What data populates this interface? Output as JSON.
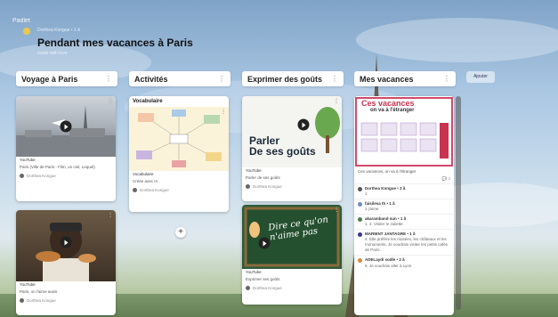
{
  "app": {
    "brand": "Padlet"
  },
  "board": {
    "author": "Dorthea Kongue • 1 ã",
    "title": "Pendant mes vacances à Paris",
    "subtitle": "made with love"
  },
  "add_section_label": "Ajouter",
  "columns": [
    {
      "title": "Voyage à Paris",
      "cards": [
        {
          "type": "video",
          "source": "YouTube",
          "caption": "Paris (Ville de Paris - Film, un ciel, Lequel)",
          "user": "Dorthea Kongue"
        },
        {
          "type": "video",
          "source": "YouTube",
          "caption": "Paris, on l'aime aussi",
          "user": "Dorthea Kongue"
        }
      ]
    },
    {
      "title": "Activités",
      "cards": [
        {
          "type": "image",
          "heading": "Vocabulaire",
          "label": "Vocabulaire",
          "caption": "Créée avec IA",
          "user": "Dorthea Kongue"
        }
      ]
    },
    {
      "title": "Exprimer des goûts",
      "cards": [
        {
          "type": "video",
          "source": "YouTube",
          "overlay_line1": "Parler",
          "overlay_line2": "De ses goûts",
          "caption": "Parler de ses goûts",
          "user": "Dorthea Kongue"
        },
        {
          "type": "video",
          "source": "YouTube",
          "overlay_line1": "Dire ce qu'on",
          "overlay_line2": "n'aime pas",
          "caption": "Exprimer ses goûts",
          "user": "Dorthea Kongue"
        }
      ]
    },
    {
      "title": "Mes vacances",
      "cards": [
        {
          "type": "image",
          "overlay_line1": "Ces vacances",
          "overlay_line2": "on va à l'étranger",
          "caption": "Ces vacances, on va à l'étranger",
          "reaction_count": "3",
          "comments": [
            {
              "name": "Dorthea Kongue • 2 ã",
              "text": "1",
              "color": "#555555"
            },
            {
              "name": "faisilesa th • 1 ã",
              "text": "1 j'aime",
              "color": "#6a8fbf"
            },
            {
              "name": "akaramband sun • 1 ã",
              "text": "1. 2. Visiter le Juliette",
              "color": "#4d7a4d"
            },
            {
              "name": "MARIENT JANTAGRE • 1 ã",
              "text": "4. Elle préfère les musées, les châteaux et les monuments. Je voudrais visiter les petits cafés de Paris.",
              "color": "#3a3a8a"
            },
            {
              "name": "ADELaydi sodle • 2 ã",
              "text": "5. Je voudrais aller à Lyon",
              "color": "#d98a3a"
            }
          ]
        }
      ]
    }
  ],
  "colors": {
    "accent": "#2f6fd6",
    "header_text": "#ffffff"
  }
}
